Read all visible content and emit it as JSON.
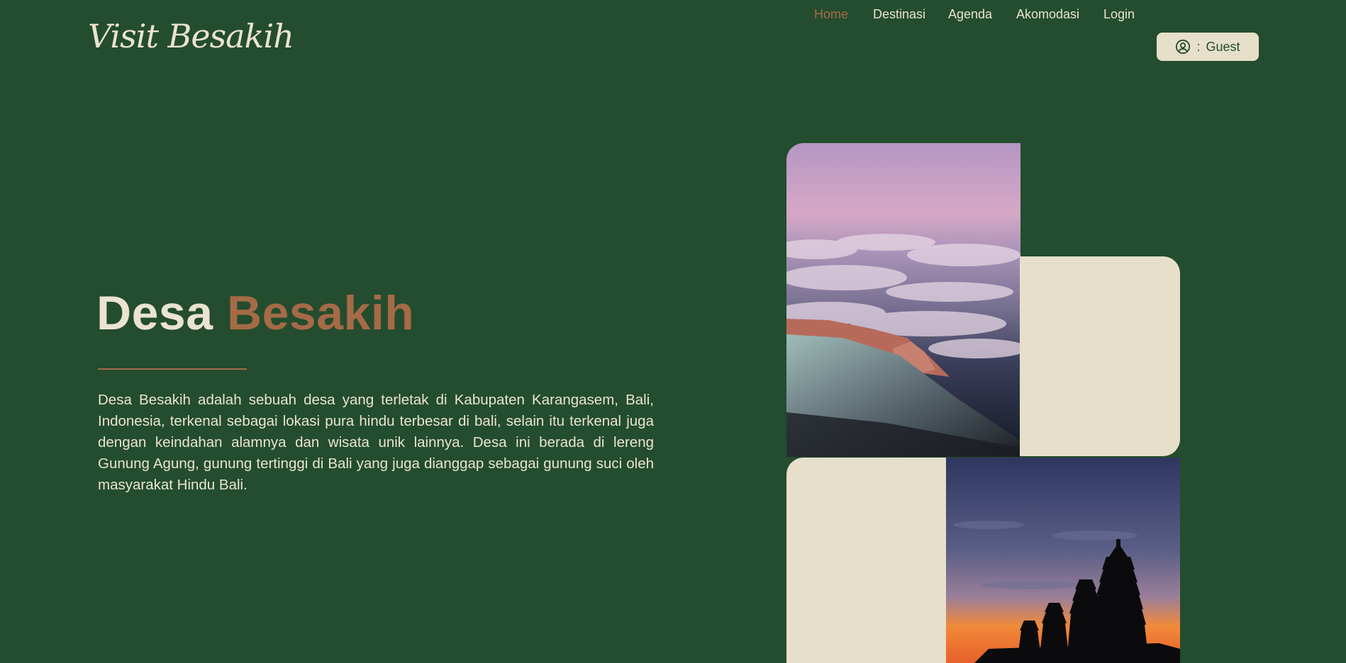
{
  "brand": {
    "logo_text": "Visit Besakih"
  },
  "nav": {
    "items": [
      {
        "label": "Home",
        "active": true
      },
      {
        "label": "Destinasi",
        "active": false
      },
      {
        "label": "Agenda",
        "active": false
      },
      {
        "label": "Akomodasi",
        "active": false
      },
      {
        "label": "Login",
        "active": false
      }
    ],
    "user_button": {
      "separator": ":",
      "label": "Guest",
      "icon": "user-circle-icon"
    }
  },
  "hero": {
    "title_first": "Desa",
    "title_accent": "Besakih",
    "description": "Desa Besakih adalah sebuah desa yang terletak di Kabupaten Karangasem, Bali, Indonesia, terkenal sebagai lokasi pura hindu terbesar di bali, selain itu terkenal juga dengan keindahan alamnya dan wisata unik lainnya. Desa ini berada di lereng Gunung Agung, gunung tertinggi di Bali yang juga dianggap sebagai gunung suci oleh masyarakat Hindu Bali."
  },
  "colors": {
    "background": "#234d2e",
    "cream": "#e6dfca",
    "accent": "#a66a47"
  }
}
